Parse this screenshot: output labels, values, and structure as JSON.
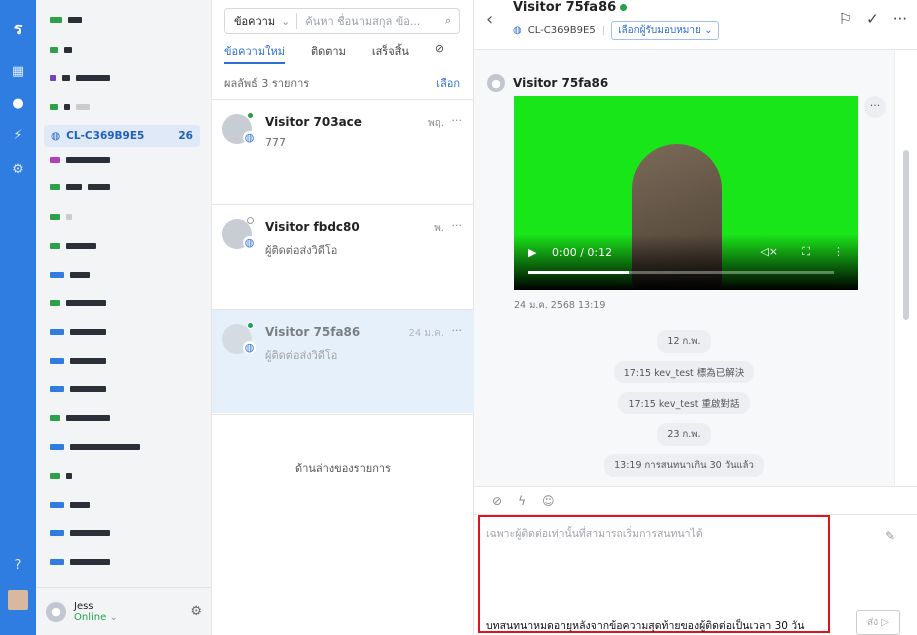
{
  "channel_sidebar": {
    "selected": {
      "name": "CL-C369B9E5",
      "count": "26"
    },
    "user": {
      "name": "Jess",
      "status": "Online"
    }
  },
  "list": {
    "search": {
      "filter": "ข้อความ",
      "placeholder": "ค้นหา ชื่อนามสกุล ข้อ..."
    },
    "tabs": [
      "ข้อความใหม่",
      "ติดตาม",
      "เสร็จสิ้น"
    ],
    "result_count": "ผลลัพธ์ 3 รายการ",
    "select_label": "เลือก",
    "conversations": [
      {
        "name": "Visitor 703ace",
        "preview": "777",
        "time": "พฤ."
      },
      {
        "name": "Visitor fbdc80",
        "preview": "ผู้ติดต่อส่งวิดีโอ",
        "time": "พ."
      },
      {
        "name": "Visitor 75fa86",
        "preview": "ผู้ติดต่อส่งวิดีโอ",
        "time": "24 ม.ค."
      }
    ],
    "end_label": "ด้านล่างของรายการ"
  },
  "chat": {
    "visitor_name": "Visitor 75fa86",
    "channel": "CL-C369B9E5",
    "assign_label": "เลือกผู้รับมอบหมาย",
    "sender": "Visitor 75fa86",
    "video": {
      "time": "0:00 / 0:12",
      "progress": 0.33
    },
    "sent_time": "24 ม.ค. 2568 13:19",
    "system": [
      "12 ก.พ.",
      "17:15 kev_test 標為已解決",
      "17:15 kev_test 重啟對話",
      "23 ก.พ.",
      "13:19 การสนทนาเกิน 30 วันแล้ว"
    ],
    "input_placeholder": "เฉพาะผู้ติดต่อเท่านั้นที่สามารถเริ่มการสนทนาได้",
    "warning": "บทสนทนาหมดอายุหลังจากข้อความสุดท้ายของผู้ติดต่อเป็นเวลา 30 วัน",
    "send_label": "ส่ง"
  }
}
